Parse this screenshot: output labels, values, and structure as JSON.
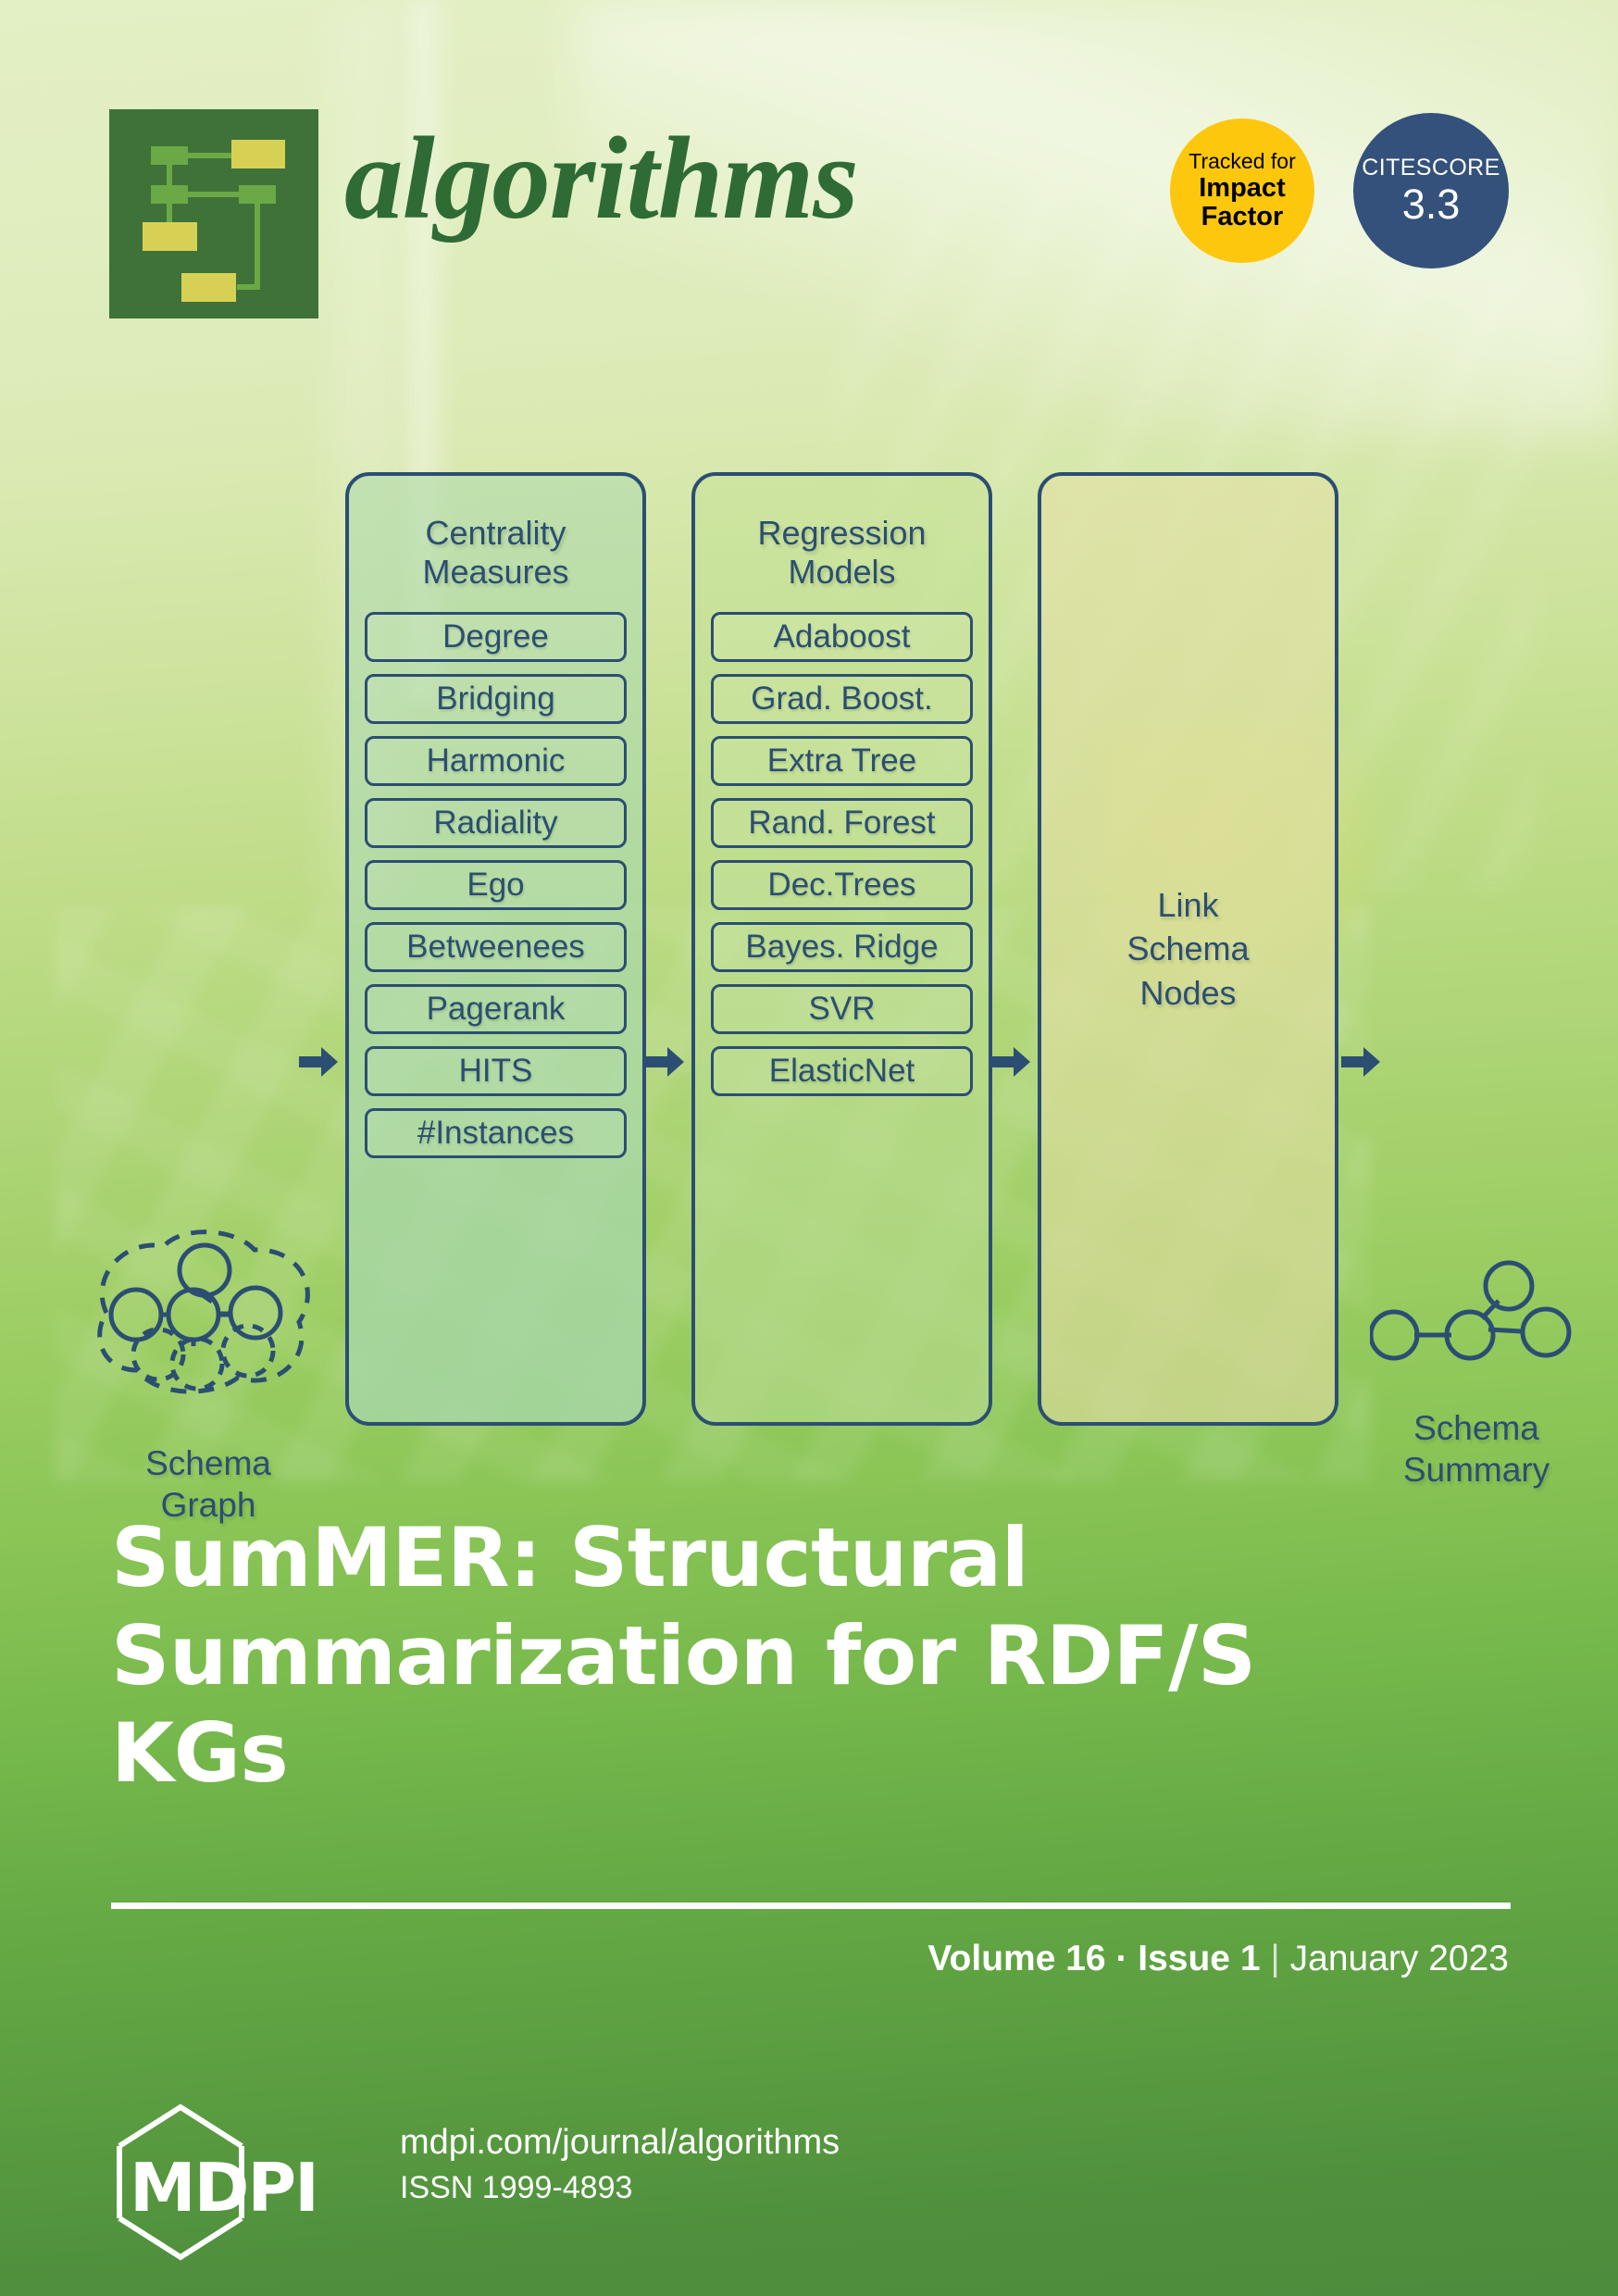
{
  "journal": {
    "name": "algorithms",
    "logo_background": "#3e7239",
    "logo_node_green": "#6aa945",
    "logo_node_yellow": "#d6d155"
  },
  "badges": [
    {
      "id": "impact-factor",
      "line1": "Tracked for",
      "line2": "Impact",
      "line3": "Factor",
      "background": "#fdc70d",
      "text_color": "#000000"
    },
    {
      "id": "citescore",
      "line1": "CITESCORE",
      "line2": "3.3",
      "background": "#33517a",
      "text_color": "#ffffff"
    }
  ],
  "diagram": {
    "accent_color": "#2c4e72",
    "input": {
      "label_line1": "Schema",
      "label_line2": "Graph",
      "icon": "schema-graph-icon"
    },
    "stages": [
      {
        "id": "centrality",
        "heading_line1": "Centrality",
        "heading_line2": "Measures",
        "items": [
          "Degree",
          "Bridging",
          "Harmonic",
          "Radiality",
          "Ego",
          "Betweenees",
          "Pagerank",
          "HITS",
          "#Instances"
        ]
      },
      {
        "id": "regression",
        "heading_line1": "Regression",
        "heading_line2": "Models",
        "items": [
          "Adaboost",
          "Grad. Boost.",
          "Extra Tree",
          "Rand. Forest",
          "Dec.Trees",
          "Bayes. Ridge",
          "SVR",
          "ElasticNet"
        ]
      },
      {
        "id": "link-schema-nodes",
        "heading_line1": "Link",
        "heading_line2": "Schema",
        "heading_line3": "Nodes",
        "items": []
      }
    ],
    "output": {
      "label_line1": "Schema",
      "label_line2": "Summary",
      "icon": "schema-summary-icon"
    }
  },
  "cover": {
    "title": "SumMER: Structural Summarization for RDF/S KGs",
    "volume": "Volume 16 · Issue 1",
    "separator": "|",
    "date": "January 2023"
  },
  "footer": {
    "publisher": "MDPI",
    "website": "mdpi.com/journal/algorithms",
    "issn": "ISSN 1999-4893"
  }
}
